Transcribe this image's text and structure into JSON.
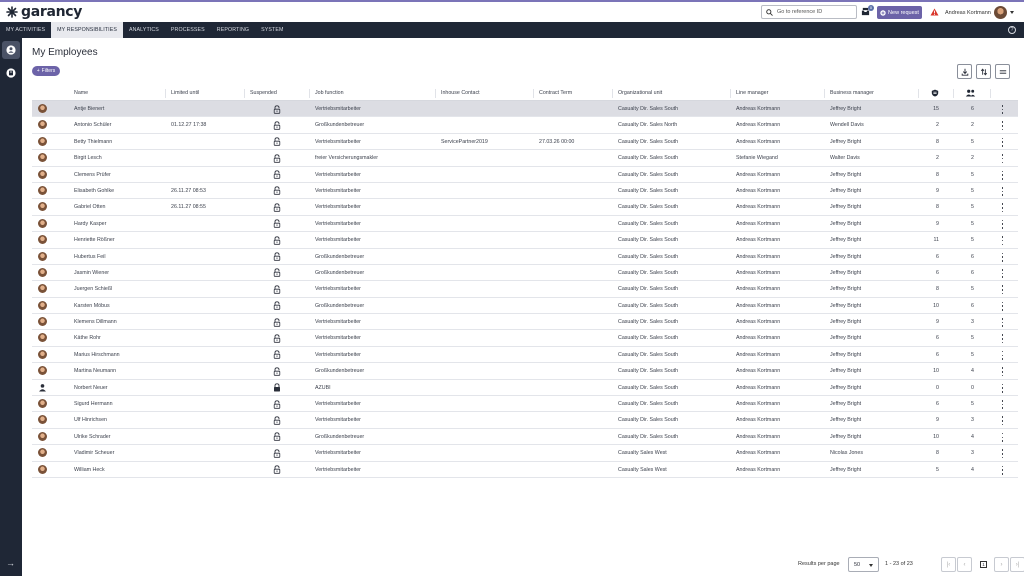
{
  "app": {
    "logo": "garancy",
    "search_placeholder": "Go to reference ID",
    "inbox_count": "0",
    "new_request_label": "New request",
    "user_name": "Andreas Kortmann"
  },
  "nav": {
    "tabs": [
      "MY ACTIVITIES",
      "MY RESPONSIBILITIES",
      "ANALYTICS",
      "PROCESSES",
      "REPORTING",
      "SYSTEM"
    ],
    "active_index": 1
  },
  "page": {
    "title": "My Employees",
    "filters_label": "Filters"
  },
  "table": {
    "columns": [
      "Name",
      "Limited until",
      "Suspended",
      "Job function",
      "Inhouse Contact",
      "Contract Term",
      "Organizational unit",
      "Line manager",
      "Business manager"
    ],
    "rows": [
      {
        "name": "Antje Bienert",
        "limited": "",
        "locked": false,
        "job": "Vertriebsmitarbeiter",
        "inhouse": "",
        "contract": "",
        "org": "Casualty Dir. Sales South",
        "line": "Andreas Kortmann",
        "business": "Jeffrey Bright",
        "n1": "15",
        "n2": "6",
        "selected": true,
        "generic": false
      },
      {
        "name": "Antonio Schüler",
        "limited": "01.12.27 17:38",
        "locked": false,
        "job": "Großkundenbetreuer",
        "inhouse": "",
        "contract": "",
        "org": "Casualty Dir. Sales North",
        "line": "Andreas Kortmann",
        "business": "Wendell Davis",
        "n1": "2",
        "n2": "2",
        "selected": false,
        "generic": false
      },
      {
        "name": "Betty Thielmann",
        "limited": "",
        "locked": false,
        "job": "Vertriebsmitarbeiter",
        "inhouse": "ServicePartner2019",
        "contract": "27.03.26 00:00",
        "org": "Casualty Dir. Sales South",
        "line": "Andreas Kortmann",
        "business": "Jeffrey Bright",
        "n1": "8",
        "n2": "5",
        "selected": false,
        "generic": false
      },
      {
        "name": "Birgit Lesch",
        "limited": "",
        "locked": false,
        "job": "freier Versicherungsmakler",
        "inhouse": "",
        "contract": "",
        "org": "Casualty Dir. Sales South",
        "line": "Stefanie Wiegand",
        "business": "Walter Davis",
        "n1": "2",
        "n2": "2",
        "selected": false,
        "generic": false
      },
      {
        "name": "Clemens Prüfer",
        "limited": "",
        "locked": false,
        "job": "Vertriebsmitarbeiter",
        "inhouse": "",
        "contract": "",
        "org": "Casualty Dir. Sales South",
        "line": "Andreas Kortmann",
        "business": "Jeffrey Bright",
        "n1": "8",
        "n2": "5",
        "selected": false,
        "generic": false
      },
      {
        "name": "Elisabeth Gohlke",
        "limited": "26.11.27 08:53",
        "locked": false,
        "job": "Vertriebsmitarbeiter",
        "inhouse": "",
        "contract": "",
        "org": "Casualty Dir. Sales South",
        "line": "Andreas Kortmann",
        "business": "Jeffrey Bright",
        "n1": "9",
        "n2": "5",
        "selected": false,
        "generic": false
      },
      {
        "name": "Gabriel Otten",
        "limited": "26.11.27 08:55",
        "locked": false,
        "job": "Vertriebsmitarbeiter",
        "inhouse": "",
        "contract": "",
        "org": "Casualty Dir. Sales South",
        "line": "Andreas Kortmann",
        "business": "Jeffrey Bright",
        "n1": "8",
        "n2": "5",
        "selected": false,
        "generic": false
      },
      {
        "name": "Hardy Kasper",
        "limited": "",
        "locked": false,
        "job": "Vertriebsmitarbeiter",
        "inhouse": "",
        "contract": "",
        "org": "Casualty Dir. Sales South",
        "line": "Andreas Kortmann",
        "business": "Jeffrey Bright",
        "n1": "9",
        "n2": "5",
        "selected": false,
        "generic": false
      },
      {
        "name": "Henriette Rößner",
        "limited": "",
        "locked": false,
        "job": "Vertriebsmitarbeiter",
        "inhouse": "",
        "contract": "",
        "org": "Casualty Dir. Sales South",
        "line": "Andreas Kortmann",
        "business": "Jeffrey Bright",
        "n1": "11",
        "n2": "5",
        "selected": false,
        "generic": false
      },
      {
        "name": "Hubertus Feil",
        "limited": "",
        "locked": false,
        "job": "Großkundenbetreuer",
        "inhouse": "",
        "contract": "",
        "org": "Casualty Dir. Sales South",
        "line": "Andreas Kortmann",
        "business": "Jeffrey Bright",
        "n1": "6",
        "n2": "6",
        "selected": false,
        "generic": false
      },
      {
        "name": "Jasmin Wiener",
        "limited": "",
        "locked": false,
        "job": "Großkundenbetreuer",
        "inhouse": "",
        "contract": "",
        "org": "Casualty Dir. Sales South",
        "line": "Andreas Kortmann",
        "business": "Jeffrey Bright",
        "n1": "6",
        "n2": "6",
        "selected": false,
        "generic": false
      },
      {
        "name": "Juergen Schießl",
        "limited": "",
        "locked": false,
        "job": "Vertriebsmitarbeiter",
        "inhouse": "",
        "contract": "",
        "org": "Casualty Dir. Sales South",
        "line": "Andreas Kortmann",
        "business": "Jeffrey Bright",
        "n1": "8",
        "n2": "5",
        "selected": false,
        "generic": false
      },
      {
        "name": "Karsten Möbus",
        "limited": "",
        "locked": false,
        "job": "Großkundenbetreuer",
        "inhouse": "",
        "contract": "",
        "org": "Casualty Dir. Sales South",
        "line": "Andreas Kortmann",
        "business": "Jeffrey Bright",
        "n1": "10",
        "n2": "6",
        "selected": false,
        "generic": false
      },
      {
        "name": "Klemens Dillmann",
        "limited": "",
        "locked": false,
        "job": "Vertriebsmitarbeiter",
        "inhouse": "",
        "contract": "",
        "org": "Casualty Dir. Sales South",
        "line": "Andreas Kortmann",
        "business": "Jeffrey Bright",
        "n1": "9",
        "n2": "3",
        "selected": false,
        "generic": false
      },
      {
        "name": "Käthe Rohr",
        "limited": "",
        "locked": false,
        "job": "Vertriebsmitarbeiter",
        "inhouse": "",
        "contract": "",
        "org": "Casualty Dir. Sales South",
        "line": "Andreas Kortmann",
        "business": "Jeffrey Bright",
        "n1": "6",
        "n2": "5",
        "selected": false,
        "generic": false
      },
      {
        "name": "Marius Hirschmann",
        "limited": "",
        "locked": false,
        "job": "Vertriebsmitarbeiter",
        "inhouse": "",
        "contract": "",
        "org": "Casualty Dir. Sales South",
        "line": "Andreas Kortmann",
        "business": "Jeffrey Bright",
        "n1": "6",
        "n2": "5",
        "selected": false,
        "generic": false
      },
      {
        "name": "Martina Neumann",
        "limited": "",
        "locked": false,
        "job": "Großkundenbetreuer",
        "inhouse": "",
        "contract": "",
        "org": "Casualty Dir. Sales South",
        "line": "Andreas Kortmann",
        "business": "Jeffrey Bright",
        "n1": "10",
        "n2": "4",
        "selected": false,
        "generic": false
      },
      {
        "name": "Norbert Neuer",
        "limited": "",
        "locked": true,
        "job": "AZUBI",
        "inhouse": "",
        "contract": "",
        "org": "Casualty Dir. Sales South",
        "line": "Andreas Kortmann",
        "business": "Jeffrey Bright",
        "n1": "0",
        "n2": "0",
        "selected": false,
        "generic": true
      },
      {
        "name": "Sigurd Hermann",
        "limited": "",
        "locked": false,
        "job": "Vertriebsmitarbeiter",
        "inhouse": "",
        "contract": "",
        "org": "Casualty Dir. Sales South",
        "line": "Andreas Kortmann",
        "business": "Jeffrey Bright",
        "n1": "6",
        "n2": "5",
        "selected": false,
        "generic": false
      },
      {
        "name": "Ulf Hinrichsen",
        "limited": "",
        "locked": false,
        "job": "Vertriebsmitarbeiter",
        "inhouse": "",
        "contract": "",
        "org": "Casualty Dir. Sales South",
        "line": "Andreas Kortmann",
        "business": "Jeffrey Bright",
        "n1": "9",
        "n2": "3",
        "selected": false,
        "generic": false
      },
      {
        "name": "Ulrike Schrader",
        "limited": "",
        "locked": false,
        "job": "Großkundenbetreuer",
        "inhouse": "",
        "contract": "",
        "org": "Casualty Dir. Sales South",
        "line": "Andreas Kortmann",
        "business": "Jeffrey Bright",
        "n1": "10",
        "n2": "4",
        "selected": false,
        "generic": false
      },
      {
        "name": "Vladimir Scheuer",
        "limited": "",
        "locked": false,
        "job": "Vertriebsmitarbeiter",
        "inhouse": "",
        "contract": "",
        "org": "Casualty Sales West",
        "line": "Andreas Kortmann",
        "business": "Nicolas Jones",
        "n1": "8",
        "n2": "3",
        "selected": false,
        "generic": false
      },
      {
        "name": "William Heck",
        "limited": "",
        "locked": false,
        "job": "Vertriebsmitarbeiter",
        "inhouse": "",
        "contract": "",
        "org": "Casualty Sales West",
        "line": "Andreas Kortmann",
        "business": "Jeffrey Bright",
        "n1": "5",
        "n2": "4",
        "selected": false,
        "generic": false
      }
    ]
  },
  "pagination": {
    "results_label": "Results per page",
    "per_page": "50",
    "range": "1 - 23 of 23",
    "current_page": "1"
  },
  "colors": {
    "nav_bg": "#1f2736",
    "accent": "#6c63a8",
    "selected_row": "#dcdde3"
  }
}
